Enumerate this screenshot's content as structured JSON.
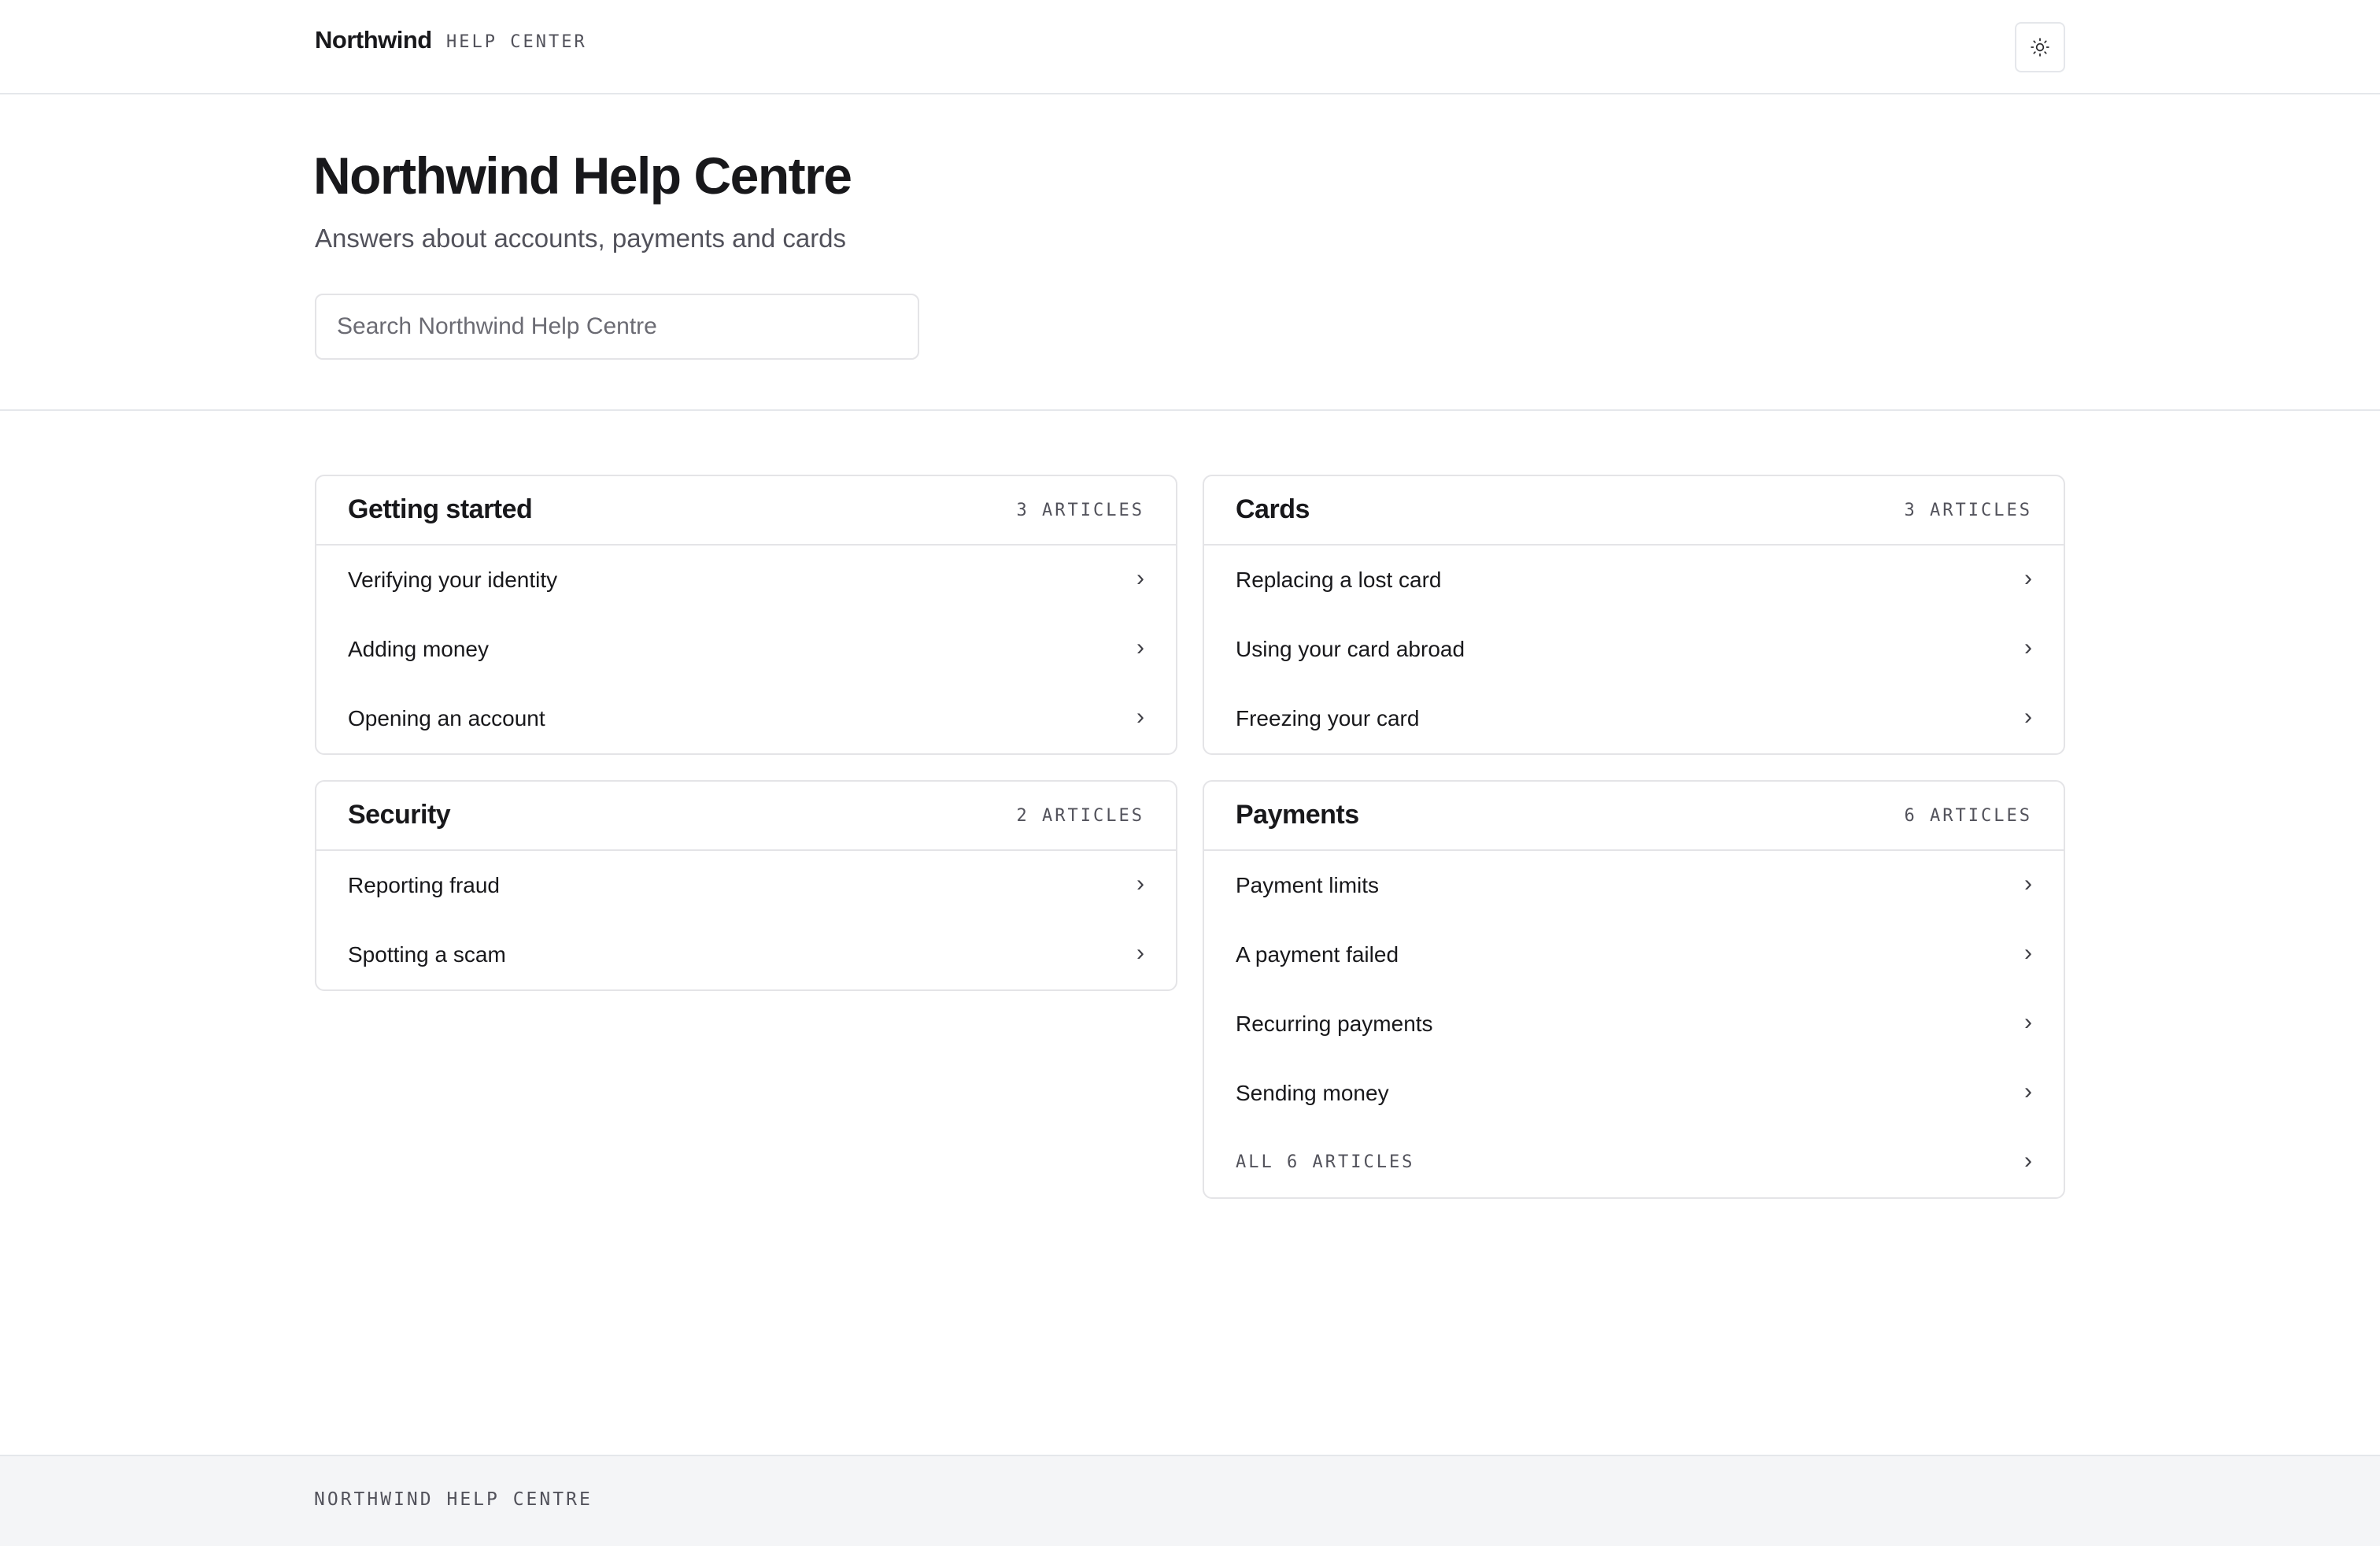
{
  "header": {
    "brand": "Northwind",
    "subbrand": "HELP CENTER",
    "theme_toggle_icon": "sun-icon"
  },
  "hero": {
    "title": "Northwind Help Centre",
    "subtitle": "Answers about accounts, payments and cards",
    "search_placeholder": "Search Northwind Help Centre",
    "search_value": ""
  },
  "categories": {
    "getting_started": {
      "title": "Getting started",
      "count": "3 ARTICLES",
      "articles": [
        "Verifying your identity",
        "Adding money",
        "Opening an account"
      ]
    },
    "cards": {
      "title": "Cards",
      "count": "3 ARTICLES",
      "articles": [
        "Replacing a lost card",
        "Using your card abroad",
        "Freezing your card"
      ]
    },
    "security": {
      "title": "Security",
      "count": "2 ARTICLES",
      "articles": [
        "Reporting fraud",
        "Spotting a scam"
      ]
    },
    "payments": {
      "title": "Payments",
      "count": "6 ARTICLES",
      "articles": [
        "Payment limits",
        "A payment failed",
        "Recurring payments",
        "Sending money"
      ],
      "view_all": "ALL 6 ARTICLES"
    }
  },
  "chevron_glyph": "›",
  "footer": {
    "text": "NORTHWIND HELP CENTRE"
  },
  "colors": {
    "text": "#18181b",
    "muted": "#52525b",
    "border": "#e4e4e7",
    "footer_bg": "#f4f5f7"
  }
}
